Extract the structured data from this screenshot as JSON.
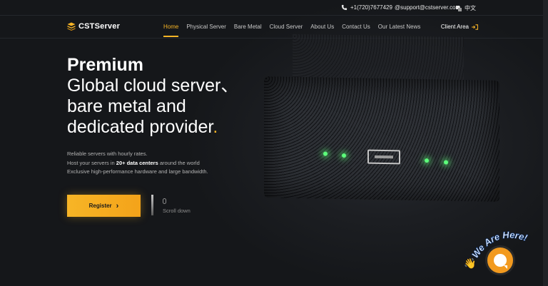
{
  "topbar": {
    "phone": "+1(720)7677429",
    "email": "@support@cstserver.com",
    "language": "中文"
  },
  "nav": {
    "logo_text": "CSTServer",
    "items": [
      "Home",
      "Physical Server",
      "Bare Metal",
      "Cloud Server",
      "About Us",
      "Contact Us",
      "Our Latest News"
    ],
    "active": "Home",
    "client_area": "Client Area"
  },
  "hero": {
    "line1": "Premium",
    "line2": "Global cloud server、",
    "line3": "bare metal and",
    "line4": "dedicated provider",
    "line4_dot": ".",
    "desc1": "Reliable servers with hourly rates.",
    "desc2_pre": "Host your servers in ",
    "desc2_bold": "20+ data centers",
    "desc2_post": " around the world",
    "desc3": "Exclusive high-performance hardware and large bandwidth.",
    "register": "Register",
    "register_arrow": "›",
    "scroll_down": "Scroll down"
  },
  "widget": {
    "text": "We Are Here!",
    "wave_emoji": "👋"
  },
  "colors": {
    "accent": "#f6b426",
    "background": "#16181c",
    "led": "#5cff7a"
  }
}
